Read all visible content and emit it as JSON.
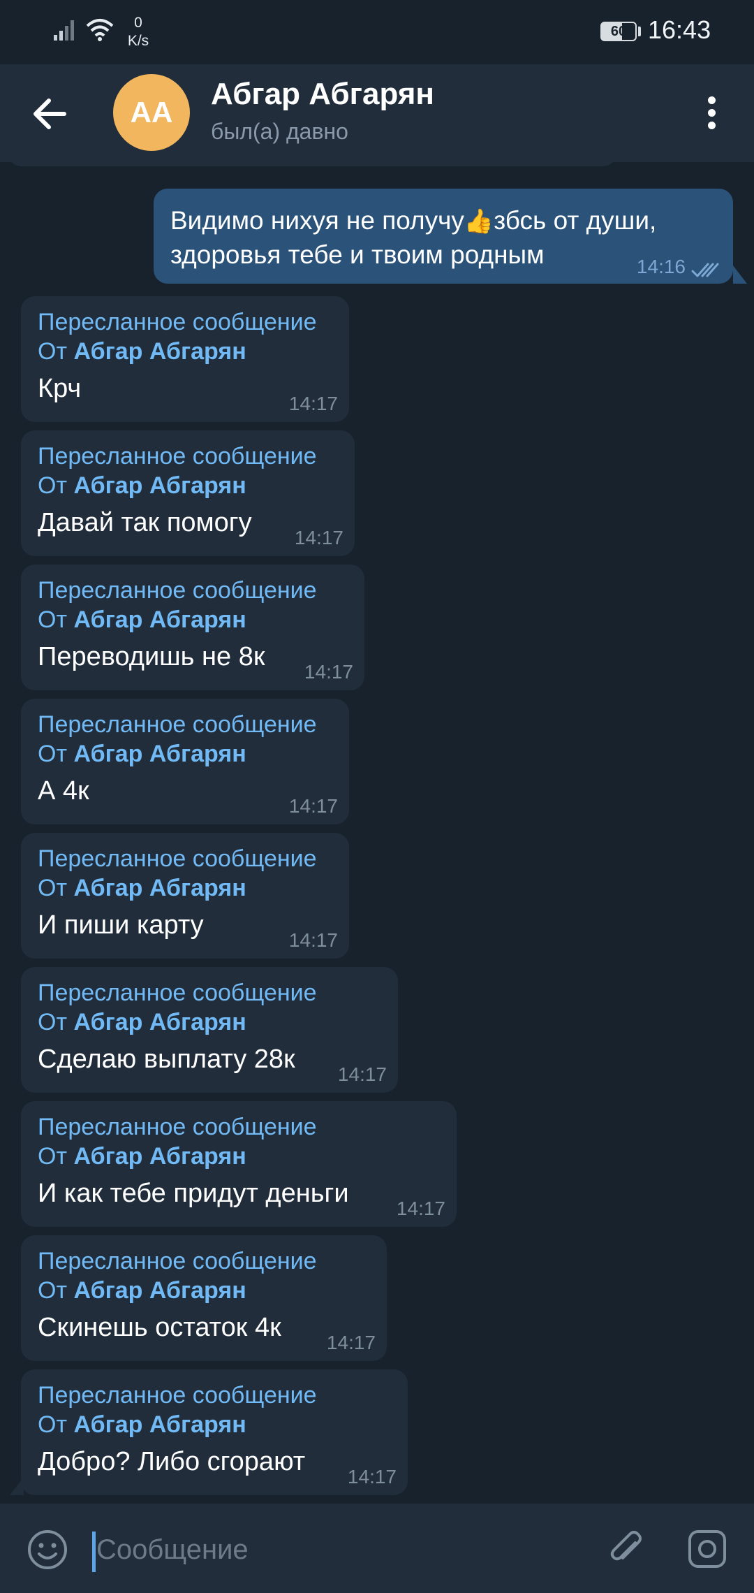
{
  "status_bar": {
    "speed_value": "0",
    "speed_unit": "K/s",
    "battery": "60",
    "time": "16:43"
  },
  "header": {
    "avatar_initials": "AA",
    "name": "Абгар Абгарян",
    "status": "был(а) давно"
  },
  "outgoing": {
    "line1_before": "Видимо нихуя не получу",
    "thumb_emoji": "👍",
    "line1_after": "збсь от души,",
    "line2": "здоровья тебе и твоим родным",
    "time": "14:16"
  },
  "forward": {
    "label": "Пересланное сообщение",
    "from_prefix": "От ",
    "from_name": "Абгар Абгарян"
  },
  "messages": [
    {
      "text": "Крч",
      "time": "14:17"
    },
    {
      "text": "Давай так помогу",
      "time": "14:17"
    },
    {
      "text": "Переводишь не 8к",
      "time": "14:17"
    },
    {
      "text": "А 4к",
      "time": "14:17"
    },
    {
      "text": "И пиши карту",
      "time": "14:17"
    },
    {
      "text": "Сделаю выплату 28к",
      "time": "14:17"
    },
    {
      "text": "И как тебе придут деньги",
      "time": "14:17"
    },
    {
      "text": "Скинешь остаток 4к",
      "time": "14:17"
    },
    {
      "text": "Добро? Либо сгорают",
      "time": "14:17"
    }
  ],
  "input": {
    "placeholder": "Сообщение"
  },
  "colors": {
    "background": "#18222d",
    "header": "#212d3b",
    "outgoing_bubble": "#2b5278",
    "incoming_bubble": "#212d3b",
    "accent_blue": "#71baf5",
    "avatar": "#f1b65e"
  }
}
